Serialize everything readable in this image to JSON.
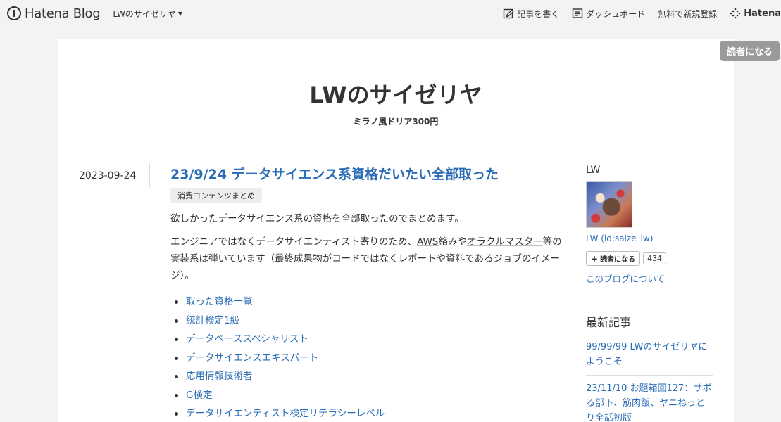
{
  "header": {
    "logo_text": "Hatena Blog",
    "blog_switch": "LWのサイゼリヤ",
    "write_label": "記事を書く",
    "dashboard_label": "ダッシュボード",
    "register_label": "無料で新規登録",
    "hatena_label": "Hatena"
  },
  "subscribe_top": "読者になる",
  "blog": {
    "title": "LWのサイゼリヤ",
    "description": "ミラノ風ドリア300円"
  },
  "entry": {
    "date": "2023-09-24",
    "title": "23/9/24 データサイエンス系資格だいたい全部取った",
    "category": "消費コンテンツまとめ",
    "p1": "欲しかったデータサイエンス系の資格を全部取ったのでまとめます。",
    "p2_pre": "エンジニアではなくデータサイエンティスト寄りのため、",
    "p2_link1": "AWS",
    "p2_mid": "絡みや",
    "p2_link2": "オラクルマスター",
    "p2_post": "等の実装系は弾いています（最終成果物がコードではなくレポートや資料であるジョブのイメージ）。",
    "toc": [
      "取った資格一覧",
      "統計検定1級",
      "データベーススペシャリスト",
      "データサイエンスエキスパート",
      "応用情報技術者",
      "G検定",
      "データサイエンティスト検定リテラシーレベル"
    ]
  },
  "sidebar": {
    "user_name": "LW",
    "user_link": "LW (id:saize_lw)",
    "subscribe_label": "読者になる",
    "subscriber_count": "434",
    "about_label": "このブログについて",
    "recent_heading": "最新記事",
    "recent": [
      "99/99/99 LWのサイゼリヤにようこそ",
      "23/11/10 お題箱回127：サボる部下、筋肉飯、ヤニねっとり全話初版"
    ]
  }
}
